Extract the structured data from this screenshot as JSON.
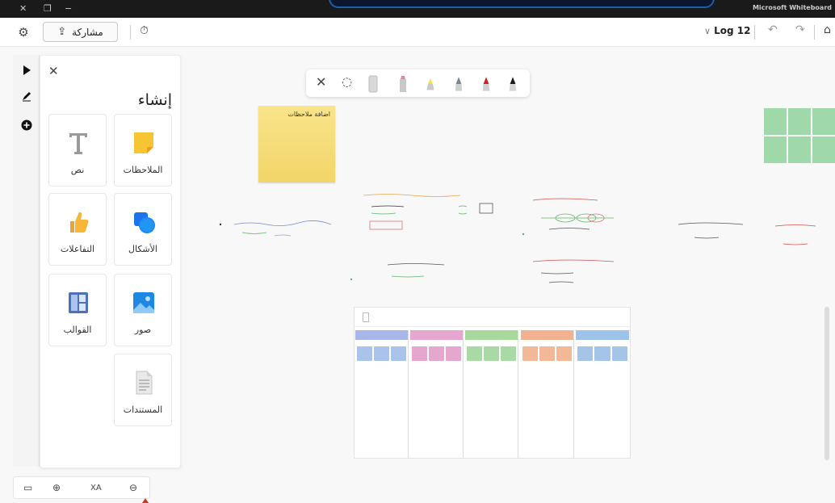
{
  "titlebar": {
    "close_glyph": "✕",
    "restore_glyph": "❐",
    "minimize_glyph": "−",
    "app_title": "Microsoft Whiteboard"
  },
  "commandbar": {
    "settings_icon": "gear-icon",
    "share_label": "مشاركة",
    "share_icon": "share-icon",
    "timer_icon": "timer-icon",
    "board_name": "Log 12",
    "undo_icon": "undo-icon",
    "redo_icon": "redo-icon",
    "home_icon": "home-icon"
  },
  "rail": {
    "tools": [
      "select-arrow-icon",
      "pen-icon",
      "add-icon"
    ]
  },
  "create_panel": {
    "title": "إنشاء",
    "close_glyph": "✕",
    "items": [
      {
        "label": "الملاحظات",
        "icon": "sticky-note-icon"
      },
      {
        "label": "نص",
        "icon": "text-icon"
      },
      {
        "label": "الأشكال",
        "icon": "shapes-icon"
      },
      {
        "label": "التفاعلات",
        "icon": "reactions-icon"
      },
      {
        "label": "صور",
        "icon": "image-icon"
      },
      {
        "label": "القوالب",
        "icon": "templates-icon"
      },
      {
        "label": "المستندات",
        "icon": "document-icon"
      }
    ]
  },
  "bottombar": {
    "fit_icon": "fit-screen-icon",
    "zoom_in_icon": "zoom-in-icon",
    "zoom_label": "XA",
    "zoom_out_icon": "zoom-out-icon"
  },
  "inkbar": {
    "close_glyph": "✕",
    "lasso_icon": "lasso-icon",
    "pens": [
      {
        "name": "eraser",
        "color": "#d9d9d9"
      },
      {
        "name": "highlighter-pink",
        "color": "#e08a9a"
      },
      {
        "name": "highlighter-yellow",
        "color": "#f3e33b"
      },
      {
        "name": "pen-gray",
        "color": "#7a8595"
      },
      {
        "name": "pen-red",
        "color": "#d0202e"
      },
      {
        "name": "pen-black",
        "color": "#1b1b1b"
      }
    ]
  },
  "canvas": {
    "sticky_note_text": "اضافة ملاحظات",
    "board_columns": [
      {
        "color": "#a9b6ea",
        "card": "#a9c3ea"
      },
      {
        "color": "#e7a6cf",
        "card": "#e6a7cf"
      },
      {
        "color": "#a6d99b",
        "card": "#a9d9a4"
      },
      {
        "color": "#f3b28f",
        "card": "#f2b898"
      },
      {
        "color": "#9dc3ea",
        "card": "#a4c4e8"
      }
    ]
  },
  "colors": {
    "accent_blue": "#1f5fa8",
    "sticky_yellow": "#f2d56a",
    "template_green": "#9fd9a9"
  }
}
